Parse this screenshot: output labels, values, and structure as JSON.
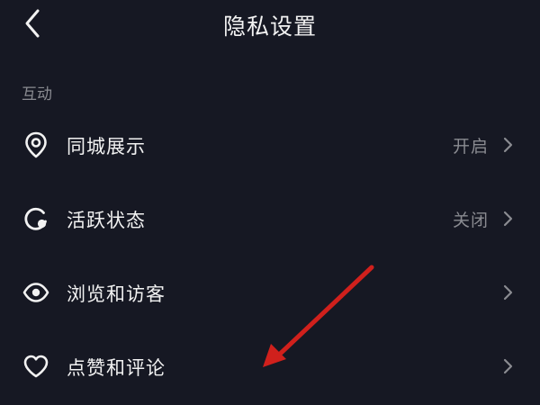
{
  "header": {
    "title": "隐私设置",
    "back_icon": "chevron-left-icon"
  },
  "section": {
    "label": "互动"
  },
  "rows": [
    {
      "label": "同城展示",
      "value": "开启",
      "icon": "location-pin-icon"
    },
    {
      "label": "活跃状态",
      "value": "关闭",
      "icon": "active-status-icon"
    },
    {
      "label": "浏览和访客",
      "value": "",
      "icon": "eye-icon"
    },
    {
      "label": "点赞和评论",
      "value": "",
      "icon": "heart-icon"
    }
  ],
  "colors": {
    "background": "#161823",
    "text_primary": "#f2f2f2",
    "text_secondary": "#8a8b91",
    "annotation_arrow": "#d0201c"
  }
}
